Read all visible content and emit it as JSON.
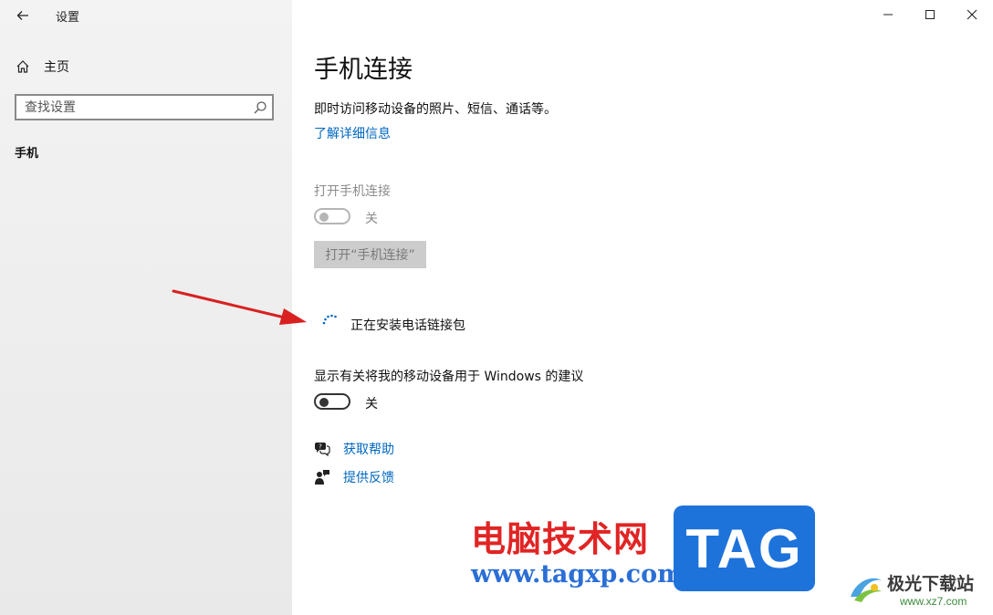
{
  "sidebar": {
    "app_title": "设置",
    "home_label": "主页",
    "search_placeholder": "查找设置",
    "section_label": "手机"
  },
  "main": {
    "title": "手机连接",
    "description": "即时访问移动设备的照片、短信、通话等。",
    "learn_more": "了解详细信息",
    "open_label": "打开手机连接",
    "open_toggle_state": "关",
    "open_button": "打开“手机连接”",
    "installing_text": "正在安装电话链接包",
    "suggest_label": "显示有关将我的移动设备用于 Windows 的建议",
    "suggest_toggle_state": "关",
    "help_link": "获取帮助",
    "feedback_link": "提供反馈"
  },
  "watermark": {
    "site_name": "电脑技术网",
    "site_url": "www.tagxp.com",
    "tag": "TAG",
    "site2_name": "极光下载站",
    "site2_url": "www.xz7.com"
  },
  "colors": {
    "accent_link": "#0067c0",
    "annotation_arrow": "#d92020"
  }
}
